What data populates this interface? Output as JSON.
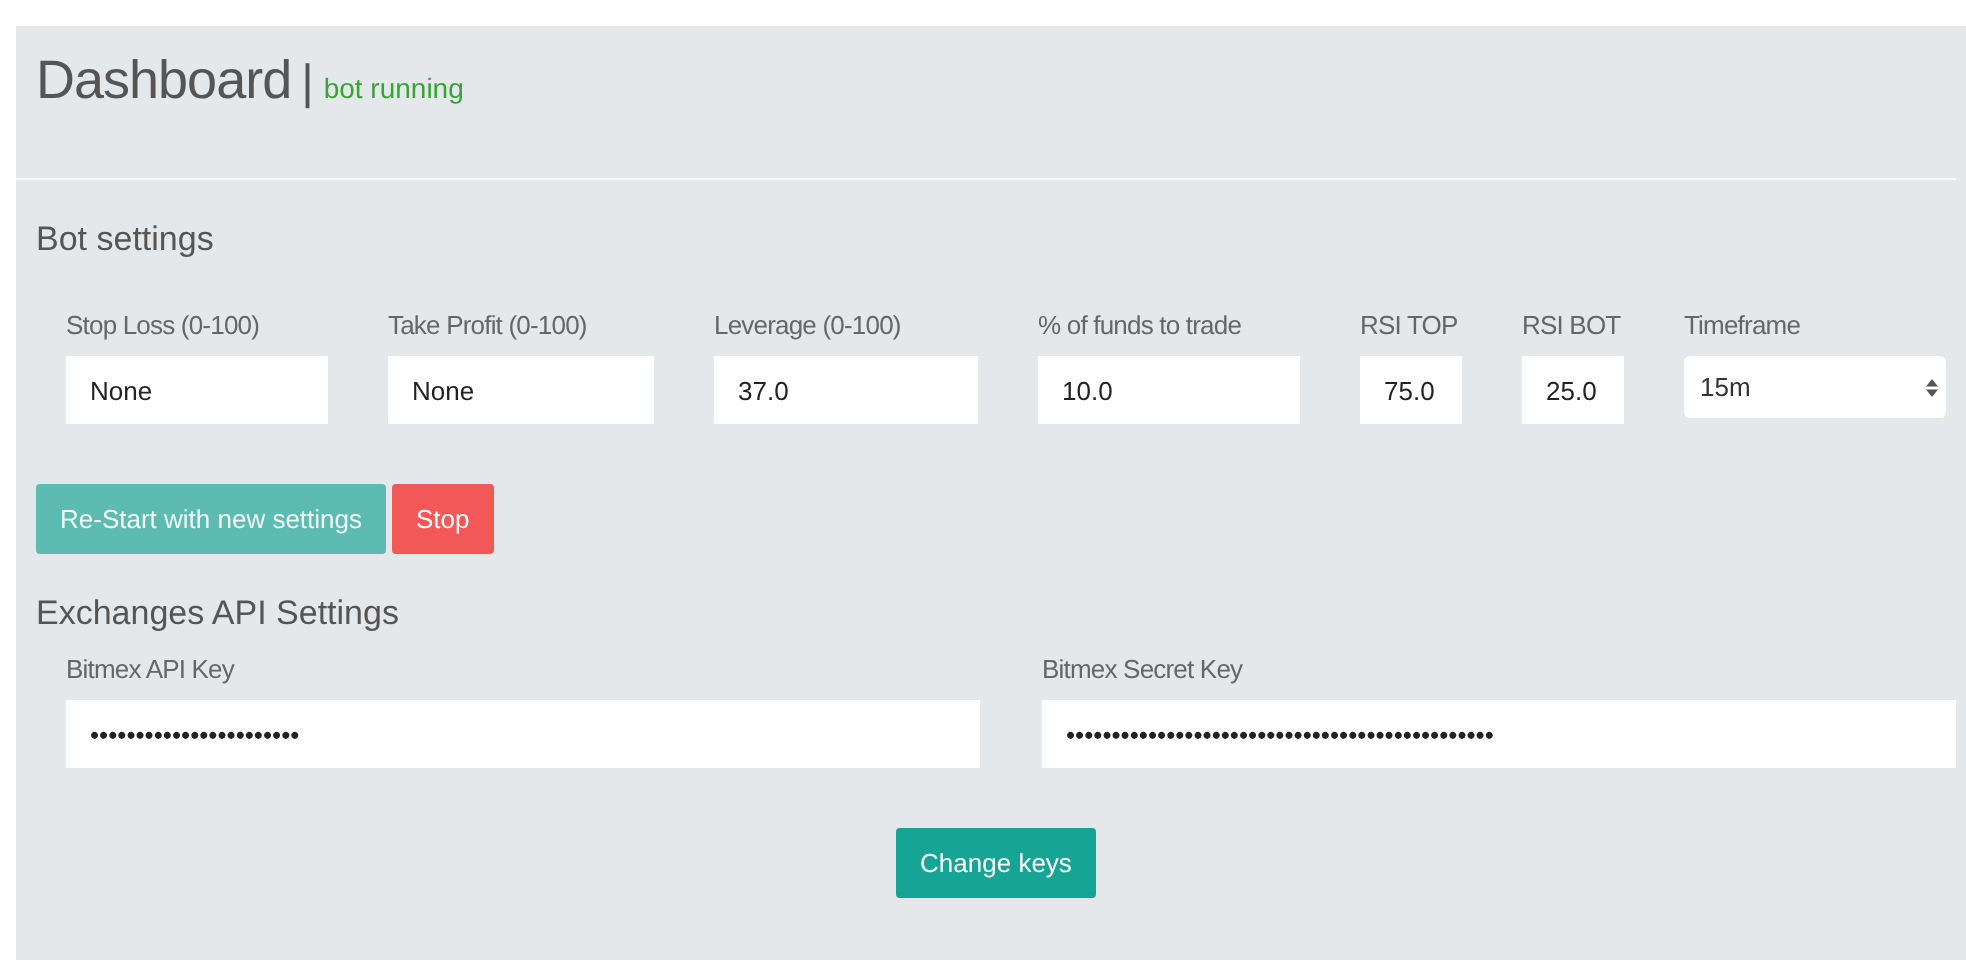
{
  "header": {
    "title": "Dashboard",
    "separator": "|",
    "status": "bot running"
  },
  "bot_settings": {
    "heading": "Bot settings",
    "fields": [
      {
        "label": "Stop Loss (0-100)",
        "value": "None",
        "kind": "text"
      },
      {
        "label": "Take Profit (0-100)",
        "value": "None",
        "kind": "text"
      },
      {
        "label": "Leverage (0-100)",
        "value": "37.0",
        "kind": "text"
      },
      {
        "label": "% of funds to trade",
        "value": "10.0",
        "kind": "text"
      },
      {
        "label": "RSI TOP",
        "value": "75.0",
        "kind": "text"
      },
      {
        "label": "RSI BOT",
        "value": "25.0",
        "kind": "text"
      },
      {
        "label": "Timeframe",
        "value": "15m",
        "kind": "select"
      }
    ],
    "buttons": [
      {
        "label": "Re-Start with new settings",
        "kind": "primary",
        "disabled": true
      },
      {
        "label": "Stop",
        "kind": "danger",
        "disabled": false
      }
    ]
  },
  "api_settings": {
    "heading": "Exchanges API Settings",
    "fields": [
      {
        "label": "Bitmex API Key",
        "value": "•••••••••••••••••••••••"
      },
      {
        "label": "Bitmex Secret Key",
        "value": "•••••••••••••••••••••••••••••••••••••••••••••••"
      }
    ],
    "button": {
      "label": "Change keys",
      "kind": "primary",
      "disabled": false
    }
  }
}
